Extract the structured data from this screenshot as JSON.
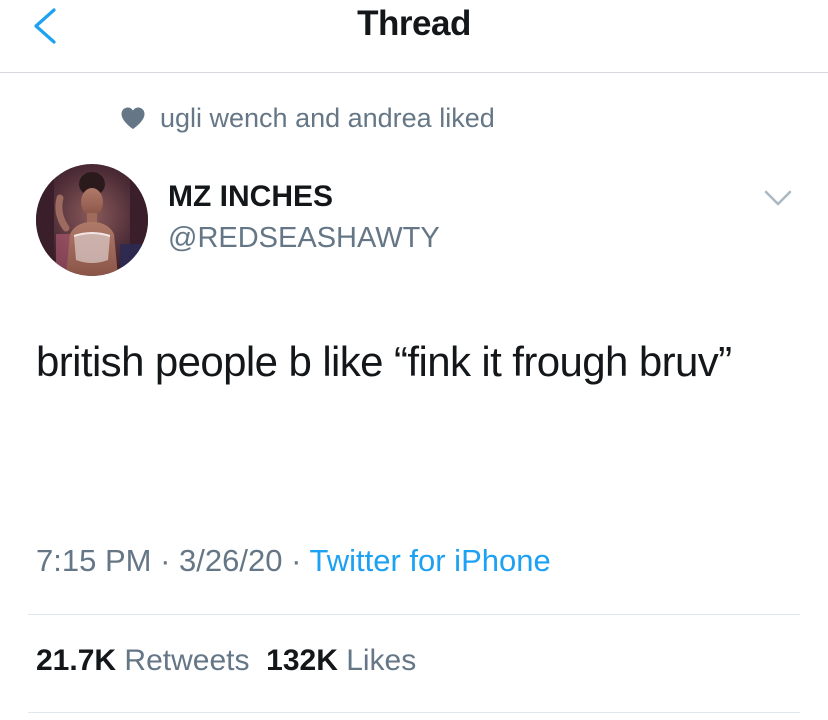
{
  "header": {
    "title": "Thread",
    "back_icon": "chevron-left-icon"
  },
  "social_context": {
    "icon": "heart-icon",
    "text": "ugli wench and andrea liked"
  },
  "tweet": {
    "author": {
      "display_name": "MZ INCHES",
      "handle": "@REDSEASHAWTY"
    },
    "text": "british people b like “fink it frough bruv”",
    "time": "7:15 PM",
    "separator": "·",
    "date": "3/26/20",
    "source": "Twitter for iPhone",
    "stats": {
      "retweets_count": "21.7K",
      "retweets_label": "Retweets",
      "likes_count": "132K",
      "likes_label": "Likes"
    }
  },
  "colors": {
    "accent": "#1da1f2",
    "secondary_text": "#657786",
    "primary_text": "#14171a",
    "divider": "#e1e8ed"
  }
}
